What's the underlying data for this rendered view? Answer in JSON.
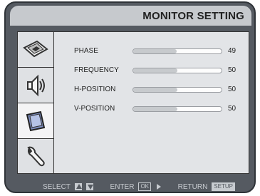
{
  "header": {
    "title": "MONITOR SETTING"
  },
  "sidebar": {
    "tabs": [
      {
        "icon": "picture-icon",
        "active": false
      },
      {
        "icon": "speaker-icon",
        "active": false
      },
      {
        "icon": "monitor-icon",
        "active": true
      },
      {
        "icon": "wrench-icon",
        "active": false
      }
    ]
  },
  "settings": [
    {
      "label": "PHASE",
      "value": "49",
      "level": 0.49
    },
    {
      "label": "FREQUENCY",
      "value": "50",
      "level": 0.5
    },
    {
      "label": "H-POSITION",
      "value": "50",
      "level": 0.5
    },
    {
      "label": "V-POSITION",
      "value": "50",
      "level": 0.5
    }
  ],
  "footer": {
    "select_label": "SELECT",
    "enter_label": "ENTER",
    "ok_key": "OK",
    "return_label": "RETURN",
    "setup_key": "SETUP"
  },
  "colors": {
    "frame": "#555a61",
    "header": "#c6c9cd",
    "panel": "#e2e4e7",
    "active_tab": "#f4f4f5"
  }
}
